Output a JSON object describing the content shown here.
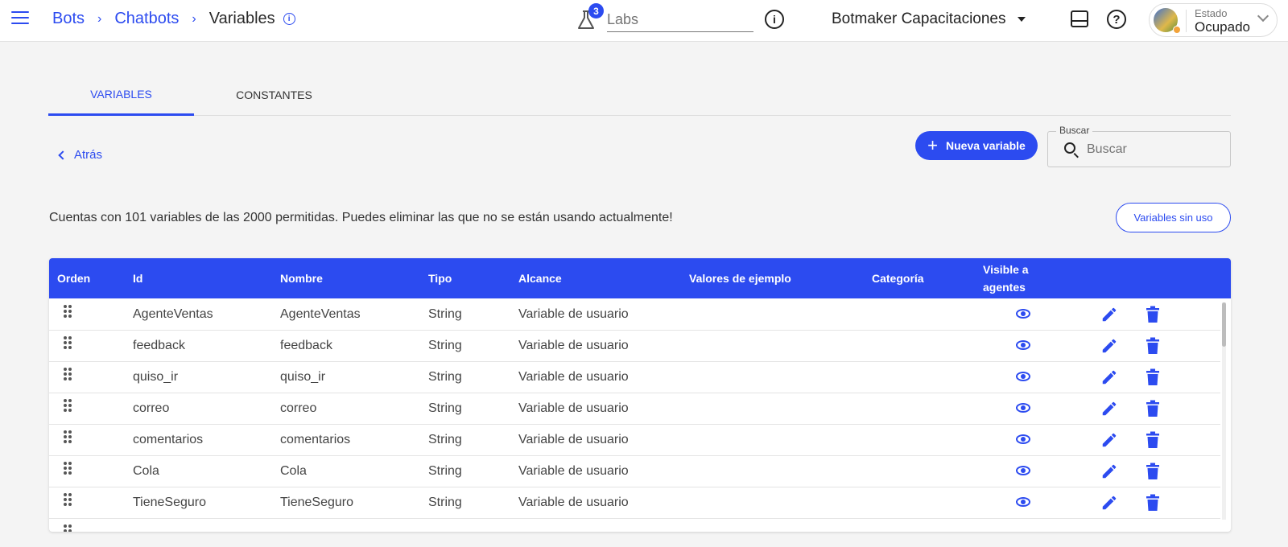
{
  "breadcrumbs": [
    "Bots",
    "Chatbots",
    "Variables"
  ],
  "labs": {
    "badge": "3",
    "placeholder": "Labs"
  },
  "account": {
    "name": "Botmaker Capacitaciones"
  },
  "status": {
    "label": "Estado",
    "value": "Ocupado",
    "dot_color": "#f2a33a"
  },
  "tabs": [
    {
      "label": "VARIABLES",
      "active": true
    },
    {
      "label": "CONSTANTES",
      "active": false
    }
  ],
  "back_label": "Atrás",
  "new_variable_label": "Nueva variable",
  "search": {
    "label": "Buscar",
    "placeholder": "Buscar"
  },
  "notice": "Cuentas con 101 variables de las 2000 permitidas. Puedes eliminar las que no se están usando actualmente!",
  "unused_button": "Variables sin uso",
  "table": {
    "headers": [
      "Orden",
      "Id",
      "Nombre",
      "Tipo",
      "Alcance",
      "Valores de ejemplo",
      "Categoría",
      "Visible a agentes"
    ],
    "rows": [
      {
        "id": "AgenteVentas",
        "name": "AgenteVentas",
        "type": "String",
        "scope": "Variable de usuario"
      },
      {
        "id": "feedback",
        "name": "feedback",
        "type": "String",
        "scope": "Variable de usuario"
      },
      {
        "id": "quiso_ir",
        "name": "quiso_ir",
        "type": "String",
        "scope": "Variable de usuario"
      },
      {
        "id": "correo",
        "name": "correo",
        "type": "String",
        "scope": "Variable de usuario"
      },
      {
        "id": "comentarios",
        "name": "comentarios",
        "type": "String",
        "scope": "Variable de usuario"
      },
      {
        "id": "Cola",
        "name": "Cola",
        "type": "String",
        "scope": "Variable de usuario"
      },
      {
        "id": "TieneSeguro",
        "name": "TieneSeguro",
        "type": "String",
        "scope": "Variable de usuario"
      }
    ]
  },
  "colors": {
    "accent": "#2c4bf0",
    "background": "#f4f4f4"
  }
}
